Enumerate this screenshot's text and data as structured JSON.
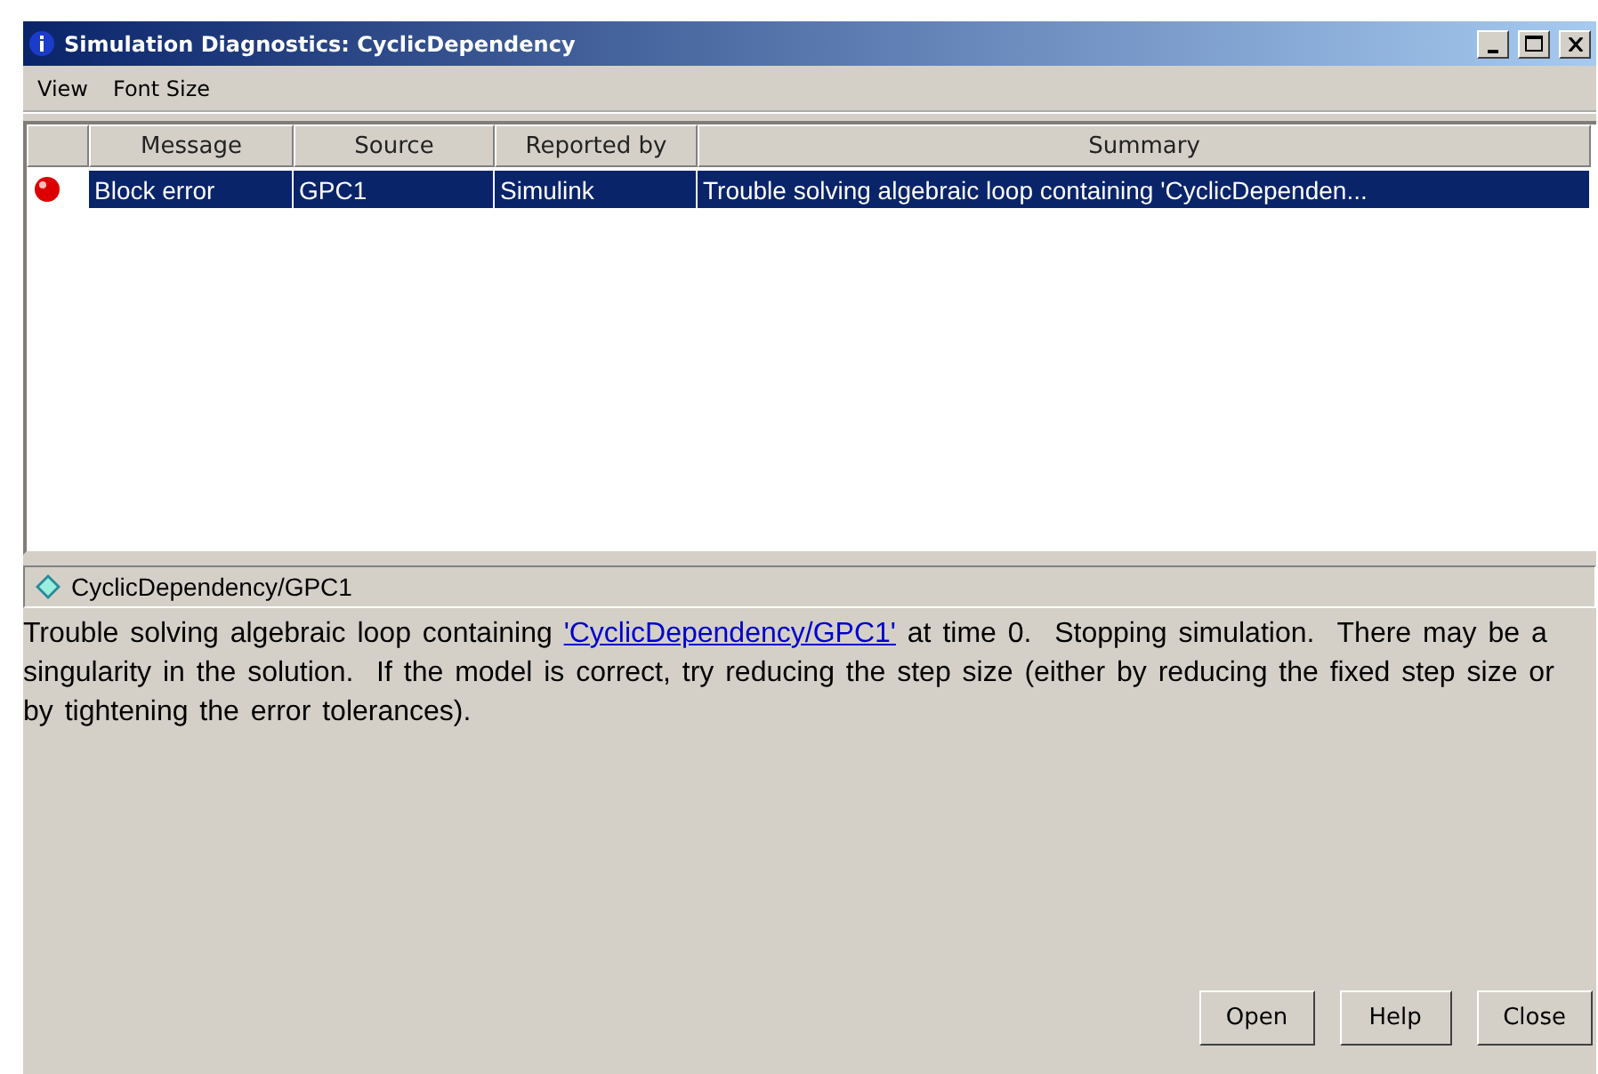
{
  "window": {
    "title": "Simulation Diagnostics: CyclicDependency"
  },
  "menu": [
    "View",
    "Font Size"
  ],
  "table": {
    "columns": [
      "Message",
      "Source",
      "Reported by",
      "Summary"
    ],
    "rows": [
      {
        "kind": "error",
        "selected": true,
        "cells": [
          "Block error",
          "GPC1",
          "Simulink",
          "Trouble solving algebraic loop containing 'CyclicDependen..."
        ]
      }
    ]
  },
  "detail": {
    "path": "CyclicDependency/GPC1",
    "text_before": "Trouble solving algebraic loop containing ",
    "link": "'CyclicDependency/GPC1'",
    "text_after": " at time 0.  Stopping simulation.  There may be a singularity in the solution.  If the model is correct, try reducing the step size (either by reducing the fixed step size or by tightening the error tolerances)."
  },
  "buttons": [
    "Open",
    "Help",
    "Close"
  ]
}
